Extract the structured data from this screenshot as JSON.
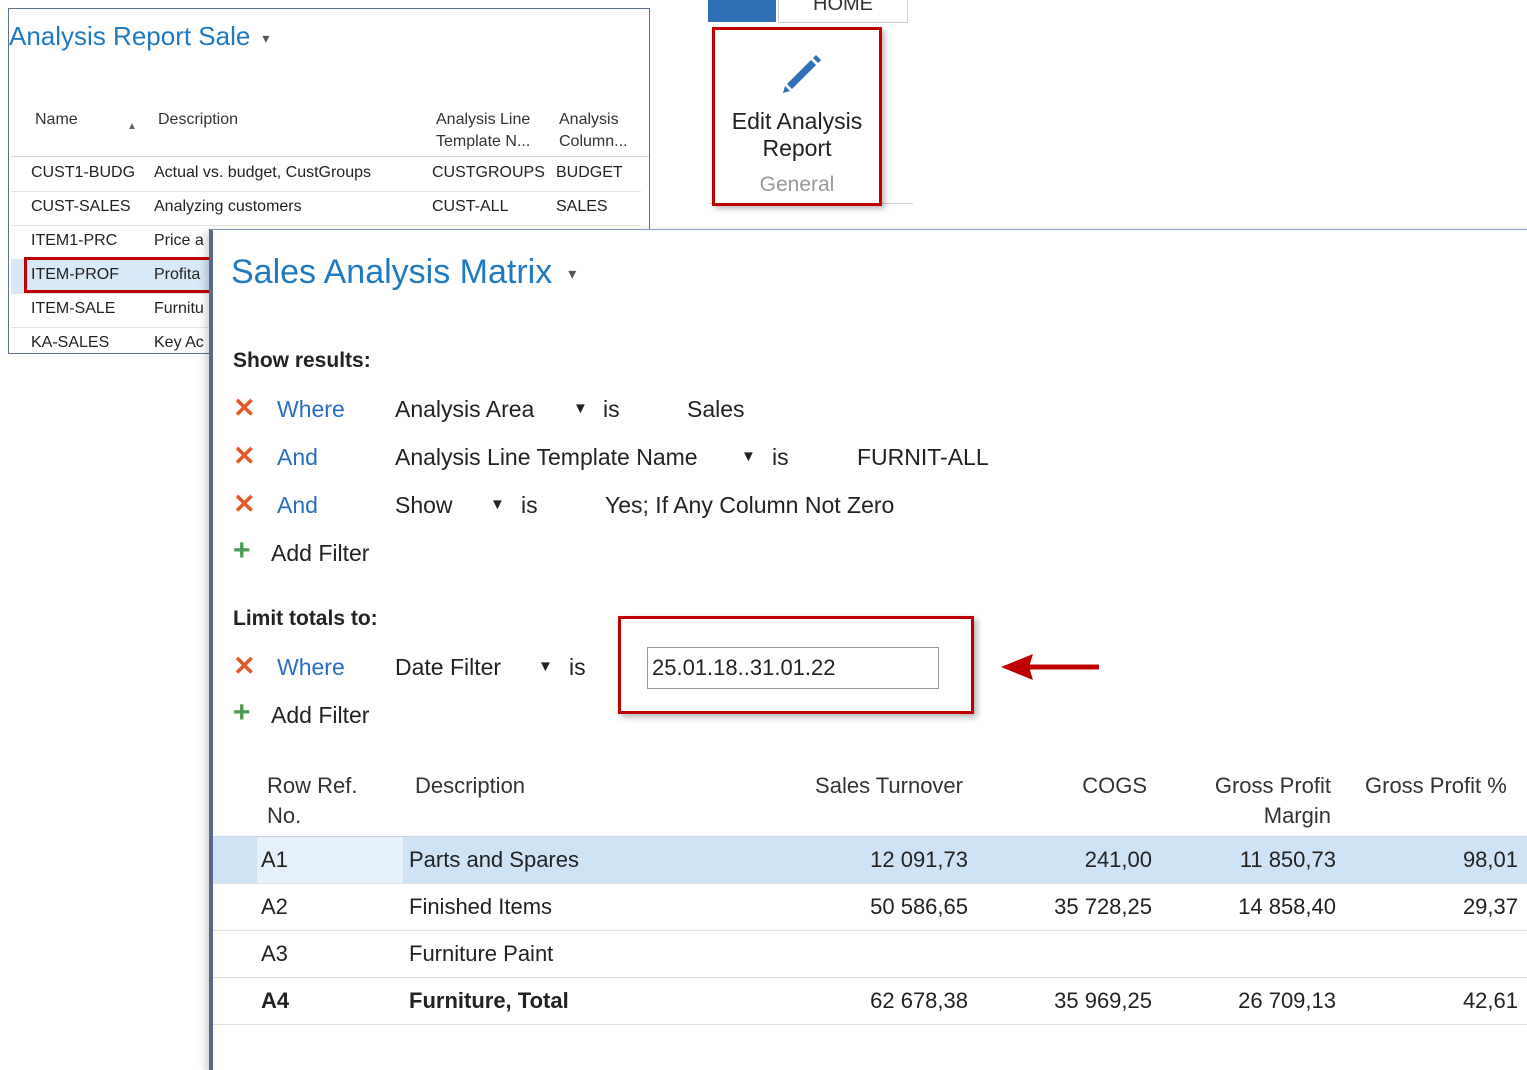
{
  "list_window": {
    "title": "Analysis Report Sale",
    "dropdown_glyph": "▾",
    "headers": {
      "name": "Name",
      "description": "Description",
      "line_template_1": "Analysis Line",
      "line_template_2": "Template N...",
      "column_1": "Analysis",
      "column_2": "Column..."
    },
    "rows": [
      {
        "name": "CUST1-BUDG",
        "description": "Actual vs. budget, CustGroups",
        "line": "CUSTGROUPS",
        "column": "BUDGET"
      },
      {
        "name": "CUST-SALES",
        "description": "Analyzing customers",
        "line": "CUST-ALL",
        "column": "SALES"
      },
      {
        "name": "ITEM1-PRC",
        "description": "Price a"
      },
      {
        "name": "ITEM-PROF",
        "description": "Profita"
      },
      {
        "name": "ITEM-SALE",
        "description": "Furnitu"
      },
      {
        "name": "KA-SALES",
        "description": "Key Ac"
      }
    ]
  },
  "ribbon": {
    "tab": "HOME",
    "action_line1": "Edit Analysis",
    "action_line2": "Report",
    "group": "General",
    "action_icon": "pencil-icon"
  },
  "matrix": {
    "title": "Sales Analysis Matrix",
    "dropdown_glyph": "▾",
    "show_results_label": "Show results:",
    "filters": [
      {
        "keyword": "Where",
        "field": "Analysis Area",
        "op": "is",
        "value": "Sales"
      },
      {
        "keyword": "And",
        "field": "Analysis Line Template Name",
        "op": "is",
        "value": "FURNIT-ALL"
      },
      {
        "keyword": "And",
        "field": "Show",
        "op": "is",
        "value": "Yes; If Any Column Not Zero"
      }
    ],
    "add_filter": "Add Filter",
    "limit_totals_label": "Limit totals to:",
    "limit_filter": {
      "keyword": "Where",
      "field": "Date Filter",
      "op": "is",
      "value": "25.01.18..31.01.22"
    },
    "add_filter_2": "Add Filter",
    "table": {
      "headers": {
        "ref_1": "Row Ref.",
        "ref_2": "No.",
        "description": "Description",
        "sales": "Sales Turnover",
        "cogs": "COGS",
        "gpm_1": "Gross Profit",
        "gpm_2": "Margin",
        "gpp": "Gross Profit %"
      },
      "rows": [
        {
          "ref": "A1",
          "description": "Parts and Spares",
          "sales": "12 091,73",
          "cogs": "241,00",
          "gpm": "11 850,73",
          "gpp": "98,01"
        },
        {
          "ref": "A2",
          "description": "Finished Items",
          "sales": "50 586,65",
          "cogs": "35 728,25",
          "gpm": "14 858,40",
          "gpp": "29,37"
        },
        {
          "ref": "A3",
          "description": "Furniture Paint",
          "sales": "",
          "cogs": "",
          "gpm": "",
          "gpp": ""
        },
        {
          "ref": "A4",
          "description": "Furniture, Total",
          "sales": "62 678,38",
          "cogs": "35 969,25",
          "gpm": "26 709,13",
          "gpp": "42,61"
        }
      ]
    }
  },
  "colors": {
    "accent_blue": "#1f7ac1",
    "highlight_red": "#c00000",
    "remove_orange": "#e05a2b",
    "add_green": "#4a9a52",
    "selection_blue": "#cfe3f6"
  }
}
